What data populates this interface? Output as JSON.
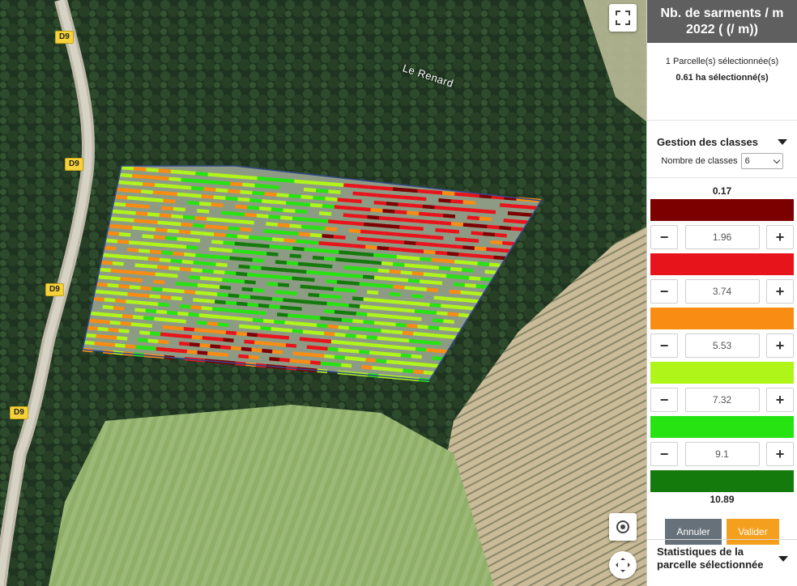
{
  "map": {
    "road_labels": [
      "D9",
      "D9",
      "D9",
      "D9"
    ],
    "place_label": "Le Renard",
    "icons": {
      "fullscreen": "fullscreen-icon",
      "locate": "locate-icon",
      "move": "move-icon"
    }
  },
  "panel": {
    "title_line1": "Nb. de sarments / m",
    "title_line2": "2022 ( (/ m))",
    "selection_parcels": "1 Parcelle(s) sélectionnée(s)",
    "selection_area": "0.61 ha sélectionné(s)",
    "classes_title": "Gestion des classes",
    "nb_classes_label": "Nombre de classes",
    "nb_classes_value": "6",
    "min_value": "0.17",
    "max_value": "10.89",
    "class_colors": [
      "#7d0000",
      "#e8141b",
      "#f98c12",
      "#b0f51a",
      "#27e312",
      "#157a0c"
    ],
    "thresholds": [
      "1.96",
      "3.74",
      "5.53",
      "7.32",
      "9.1"
    ],
    "minus": "−",
    "plus": "+",
    "cancel_label": "Annuler",
    "validate_label": "Valider",
    "stats_title_line1": "Statistiques de la",
    "stats_title_line2": "parcelle sélectionnée"
  }
}
